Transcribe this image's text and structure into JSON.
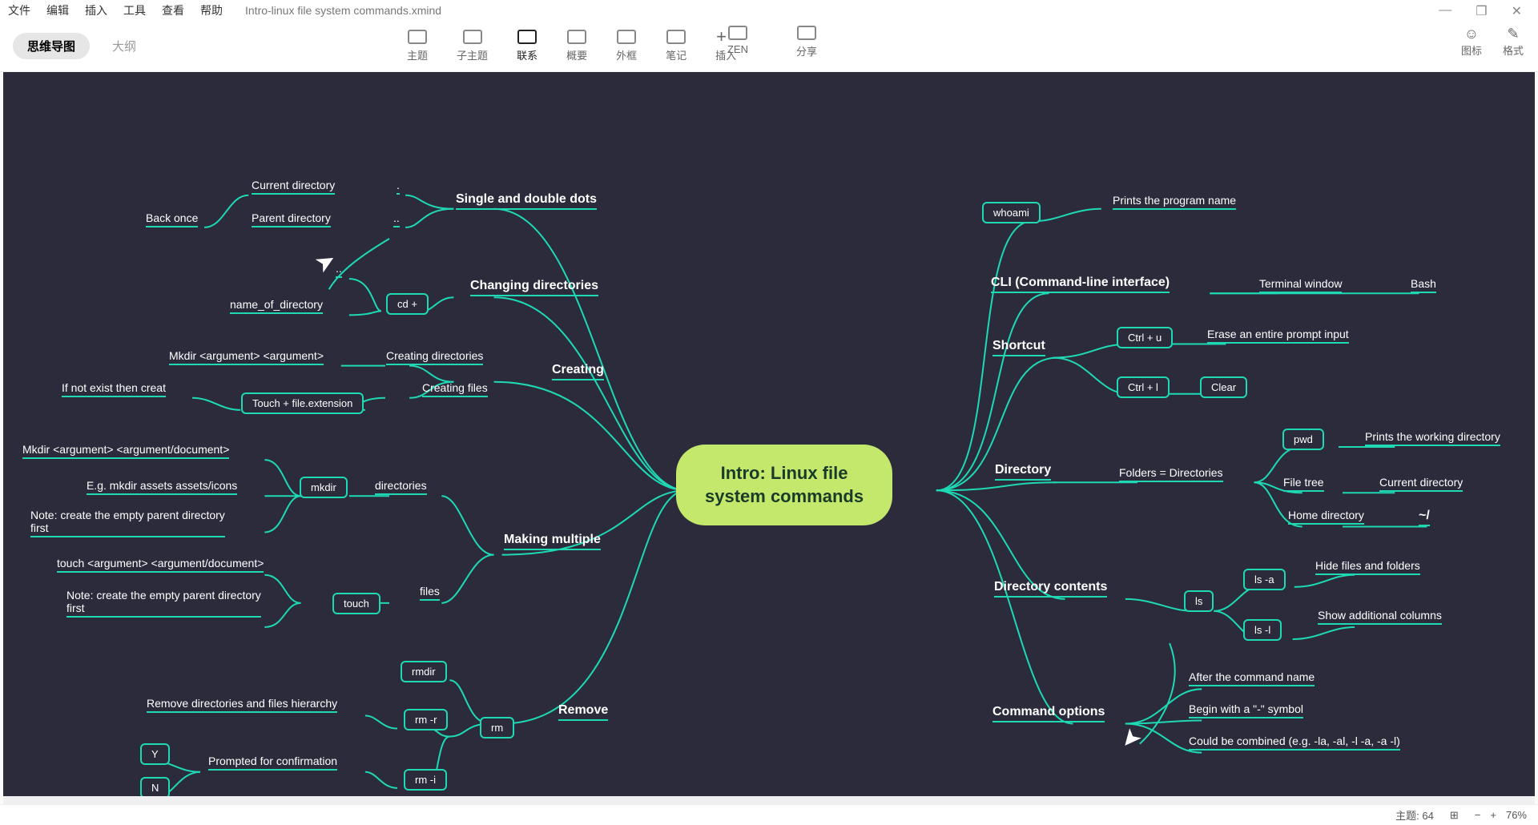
{
  "menu": {
    "file": "文件",
    "edit": "编辑",
    "insert": "插入",
    "tools": "工具",
    "view": "查看",
    "help": "帮助",
    "title": "Intro-linux file system commands.xmind"
  },
  "view": {
    "mindmap": "思维导图",
    "outline": "大纲"
  },
  "toolbar": {
    "topic": "主题",
    "subtopic": "子主题",
    "relation": "联系",
    "summary": "概要",
    "boundary": "外框",
    "notes": "笔记",
    "insert": "插入",
    "zen": "ZEN",
    "share": "分享",
    "icons": "图标",
    "format": "格式"
  },
  "status": {
    "topic_count_label": "主题:",
    "topic_count": "64",
    "zoom": "76%"
  },
  "root": "Intro: Linux file\nsystem commands",
  "left": {
    "single_dots": {
      "title": "Single and double dots",
      "current": "Current directory",
      "dot": ".",
      "parent": "Parent directory",
      "dotdot": "..",
      "back": "Back once"
    },
    "changing": {
      "title": "Changing directories",
      "cd": "cd +",
      "dotdot": "..",
      "name": "name_of_directory"
    },
    "creating": {
      "title": "Creating",
      "dirs": "Creating directories",
      "files": "Creating files",
      "mkdir": "Mkdir <argument> <argument>",
      "touch": "Touch + file.extension",
      "ifnot": "If not exist then creat"
    },
    "multiple": {
      "title": "Making multiple",
      "dirs": "directories",
      "files": "files",
      "mkdir": "mkdir",
      "touch": "touch",
      "arg1": "Mkdir <argument> <argument/document>",
      "eg": "E.g. mkdir assets assets/icons",
      "note": "Note: create the empty parent directory\nfirst",
      "targ": "touch <argument> <argument/document>",
      "note2": "Note: create the empty parent directory\nfirst"
    },
    "remove": {
      "title": "Remove",
      "rmdir": "rmdir",
      "rm": "rm",
      "rmr": "rm -r",
      "rmi": "rm -i",
      "hier": "Remove directories and files hierarchy",
      "prompt": "Prompted for confirmation",
      "y": "Y",
      "n": "N"
    }
  },
  "right": {
    "whoami": {
      "hex": "whoami",
      "prints": "Prints the program name"
    },
    "cli": {
      "title": "CLI (Command-line interface)",
      "term": "Terminal window",
      "bash": "Bash"
    },
    "shortcut": {
      "title": "Shortcut",
      "ctrlu": "Ctrl + u",
      "ctrll": "Ctrl + l",
      "erase": "Erase an entire prompt input",
      "clear": "Clear"
    },
    "directory": {
      "title": "Directory",
      "folders": "Folders = Directories",
      "pwd": "pwd",
      "prints": "Prints the working directory",
      "tree": "File tree",
      "current": "Current directory",
      "home": "Home directory",
      "tilde": "~/"
    },
    "contents": {
      "title": "Directory contents",
      "ls": "ls",
      "lsa": "ls -a",
      "lsl": "ls -l",
      "hide": "Hide files and folders",
      "cols": "Show additional columns"
    },
    "options": {
      "title": "Command options",
      "after": "After the command name",
      "begin": "Begin with a \"-\" symbol",
      "combined": "Could be combined (e.g. -la, -al, -l -a, -a -l)"
    }
  }
}
